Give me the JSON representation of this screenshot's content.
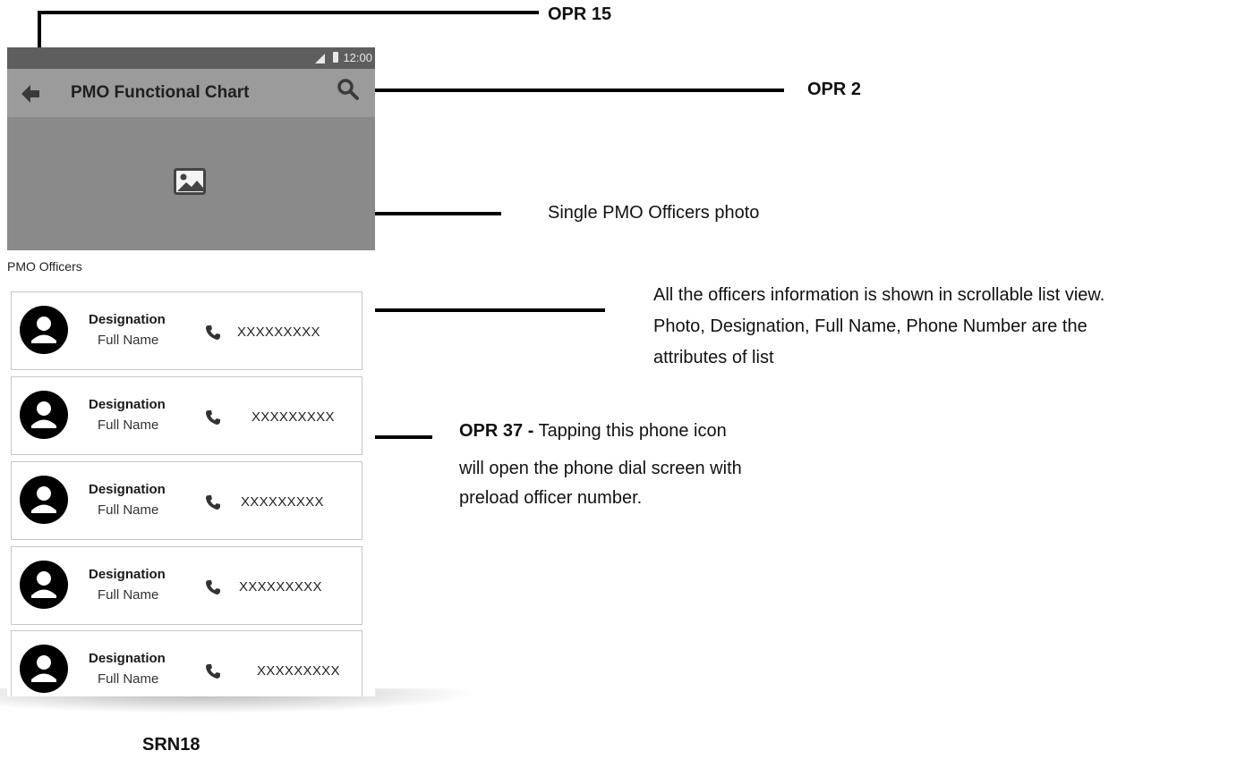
{
  "status_bar": {
    "time": "12:00"
  },
  "app_bar": {
    "title": "PMO Functional Chart",
    "back_icon": "arrow-back-icon",
    "search_icon": "search-icon"
  },
  "banner": {
    "icon": "image-icon"
  },
  "section_label": "PMO Officers",
  "officers": [
    {
      "designation": "Designation",
      "full_name": "Full Name",
      "phone": "XXXXXXXXX"
    },
    {
      "designation": "Designation",
      "full_name": "Full Name",
      "phone": "XXXXXXXXX"
    },
    {
      "designation": "Designation",
      "full_name": "Full Name",
      "phone": "XXXXXXXXX"
    },
    {
      "designation": "Designation",
      "full_name": "Full Name",
      "phone": "XXXXXXXXX"
    },
    {
      "designation": "Designation",
      "full_name": "Full Name",
      "phone": "XXXXXXXXX"
    }
  ],
  "annotations": {
    "opr15": "OPR 15",
    "opr2": "OPR 2",
    "photo_note": "Single PMO Officers photo",
    "list_note_1": "All the officers information is shown in scrollable list view.",
    "list_note_2": "Photo, Designation, Full Name, Phone Number are the",
    "list_note_3": "attributes of list",
    "opr37_label": "OPR 37 -",
    "opr37_text_1": "Tapping this phone icon",
    "opr37_text_2": "will open the phone dial screen with",
    "opr37_text_3": "preload officer number."
  },
  "screen_id": "SRN18",
  "colors": {
    "status_bar": "#5e5e5e",
    "app_bar": "#9b9b9b",
    "banner": "#8a8a8a"
  }
}
